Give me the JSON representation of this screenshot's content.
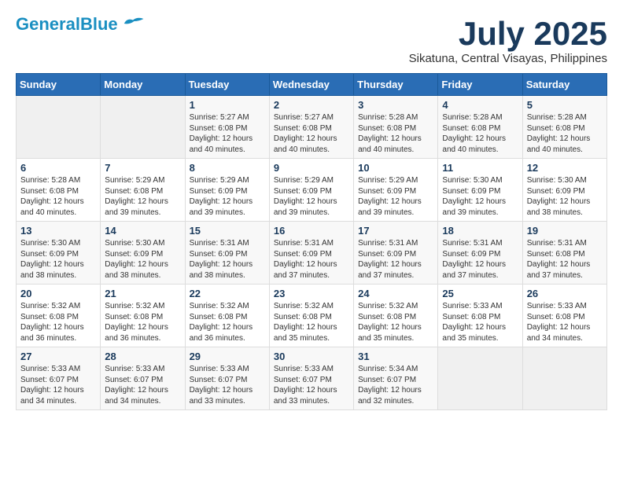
{
  "header": {
    "logo_line1": "General",
    "logo_line2": "Blue",
    "month_title": "July 2025",
    "location": "Sikatuna, Central Visayas, Philippines"
  },
  "weekdays": [
    "Sunday",
    "Monday",
    "Tuesday",
    "Wednesday",
    "Thursday",
    "Friday",
    "Saturday"
  ],
  "weeks": [
    [
      {
        "day": "",
        "info": ""
      },
      {
        "day": "",
        "info": ""
      },
      {
        "day": "1",
        "info": "Sunrise: 5:27 AM\nSunset: 6:08 PM\nDaylight: 12 hours and 40 minutes."
      },
      {
        "day": "2",
        "info": "Sunrise: 5:27 AM\nSunset: 6:08 PM\nDaylight: 12 hours and 40 minutes."
      },
      {
        "day": "3",
        "info": "Sunrise: 5:28 AM\nSunset: 6:08 PM\nDaylight: 12 hours and 40 minutes."
      },
      {
        "day": "4",
        "info": "Sunrise: 5:28 AM\nSunset: 6:08 PM\nDaylight: 12 hours and 40 minutes."
      },
      {
        "day": "5",
        "info": "Sunrise: 5:28 AM\nSunset: 6:08 PM\nDaylight: 12 hours and 40 minutes."
      }
    ],
    [
      {
        "day": "6",
        "info": "Sunrise: 5:28 AM\nSunset: 6:08 PM\nDaylight: 12 hours and 40 minutes."
      },
      {
        "day": "7",
        "info": "Sunrise: 5:29 AM\nSunset: 6:08 PM\nDaylight: 12 hours and 39 minutes."
      },
      {
        "day": "8",
        "info": "Sunrise: 5:29 AM\nSunset: 6:09 PM\nDaylight: 12 hours and 39 minutes."
      },
      {
        "day": "9",
        "info": "Sunrise: 5:29 AM\nSunset: 6:09 PM\nDaylight: 12 hours and 39 minutes."
      },
      {
        "day": "10",
        "info": "Sunrise: 5:29 AM\nSunset: 6:09 PM\nDaylight: 12 hours and 39 minutes."
      },
      {
        "day": "11",
        "info": "Sunrise: 5:30 AM\nSunset: 6:09 PM\nDaylight: 12 hours and 39 minutes."
      },
      {
        "day": "12",
        "info": "Sunrise: 5:30 AM\nSunset: 6:09 PM\nDaylight: 12 hours and 38 minutes."
      }
    ],
    [
      {
        "day": "13",
        "info": "Sunrise: 5:30 AM\nSunset: 6:09 PM\nDaylight: 12 hours and 38 minutes."
      },
      {
        "day": "14",
        "info": "Sunrise: 5:30 AM\nSunset: 6:09 PM\nDaylight: 12 hours and 38 minutes."
      },
      {
        "day": "15",
        "info": "Sunrise: 5:31 AM\nSunset: 6:09 PM\nDaylight: 12 hours and 38 minutes."
      },
      {
        "day": "16",
        "info": "Sunrise: 5:31 AM\nSunset: 6:09 PM\nDaylight: 12 hours and 37 minutes."
      },
      {
        "day": "17",
        "info": "Sunrise: 5:31 AM\nSunset: 6:09 PM\nDaylight: 12 hours and 37 minutes."
      },
      {
        "day": "18",
        "info": "Sunrise: 5:31 AM\nSunset: 6:09 PM\nDaylight: 12 hours and 37 minutes."
      },
      {
        "day": "19",
        "info": "Sunrise: 5:31 AM\nSunset: 6:08 PM\nDaylight: 12 hours and 37 minutes."
      }
    ],
    [
      {
        "day": "20",
        "info": "Sunrise: 5:32 AM\nSunset: 6:08 PM\nDaylight: 12 hours and 36 minutes."
      },
      {
        "day": "21",
        "info": "Sunrise: 5:32 AM\nSunset: 6:08 PM\nDaylight: 12 hours and 36 minutes."
      },
      {
        "day": "22",
        "info": "Sunrise: 5:32 AM\nSunset: 6:08 PM\nDaylight: 12 hours and 36 minutes."
      },
      {
        "day": "23",
        "info": "Sunrise: 5:32 AM\nSunset: 6:08 PM\nDaylight: 12 hours and 35 minutes."
      },
      {
        "day": "24",
        "info": "Sunrise: 5:32 AM\nSunset: 6:08 PM\nDaylight: 12 hours and 35 minutes."
      },
      {
        "day": "25",
        "info": "Sunrise: 5:33 AM\nSunset: 6:08 PM\nDaylight: 12 hours and 35 minutes."
      },
      {
        "day": "26",
        "info": "Sunrise: 5:33 AM\nSunset: 6:08 PM\nDaylight: 12 hours and 34 minutes."
      }
    ],
    [
      {
        "day": "27",
        "info": "Sunrise: 5:33 AM\nSunset: 6:07 PM\nDaylight: 12 hours and 34 minutes."
      },
      {
        "day": "28",
        "info": "Sunrise: 5:33 AM\nSunset: 6:07 PM\nDaylight: 12 hours and 34 minutes."
      },
      {
        "day": "29",
        "info": "Sunrise: 5:33 AM\nSunset: 6:07 PM\nDaylight: 12 hours and 33 minutes."
      },
      {
        "day": "30",
        "info": "Sunrise: 5:33 AM\nSunset: 6:07 PM\nDaylight: 12 hours and 33 minutes."
      },
      {
        "day": "31",
        "info": "Sunrise: 5:34 AM\nSunset: 6:07 PM\nDaylight: 12 hours and 32 minutes."
      },
      {
        "day": "",
        "info": ""
      },
      {
        "day": "",
        "info": ""
      }
    ]
  ]
}
